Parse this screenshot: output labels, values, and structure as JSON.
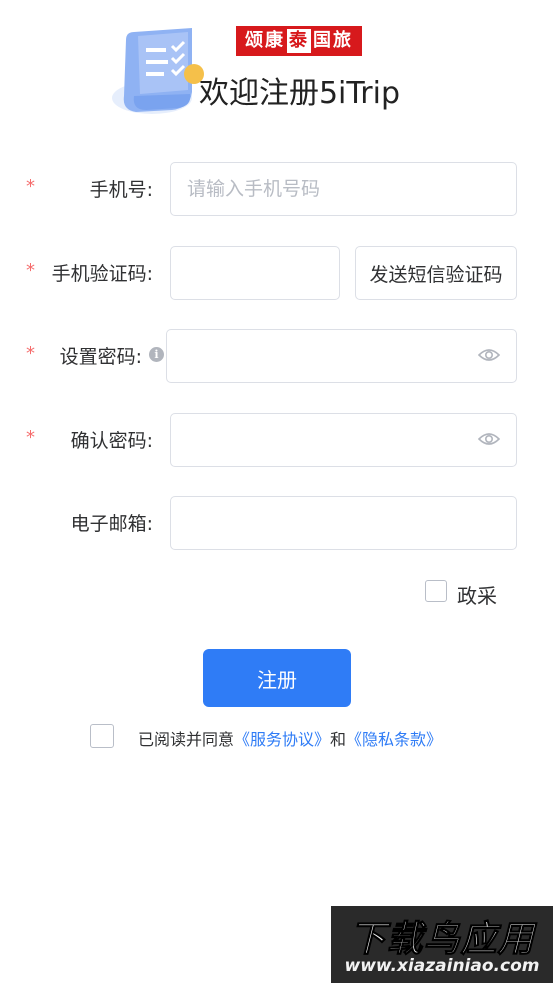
{
  "header": {
    "brand_text_left": "颂康",
    "brand_text_mid": "泰",
    "brand_text_right": "国旅",
    "title": "欢迎注册5iTrip"
  },
  "form": {
    "phone": {
      "required_mark": "*",
      "label": "手机号:",
      "placeholder": "请输入手机号码",
      "value": ""
    },
    "sms_code": {
      "required_mark": "*",
      "label": "手机验证码:",
      "value": "",
      "button_label": "发送短信验证码"
    },
    "password": {
      "required_mark": "*",
      "label": "设置密码:",
      "info_icon": "i",
      "value": ""
    },
    "confirm_password": {
      "required_mark": "*",
      "label": "确认密码:",
      "value": ""
    },
    "email": {
      "label": "电子邮箱:",
      "value": ""
    },
    "policy_checkbox_label": "政采",
    "submit_label": "注册",
    "agreement": {
      "prefix": "已阅读并同意",
      "service_link": "《服务协议》",
      "conjunction": "和",
      "privacy_link": "《隐私条款》"
    }
  },
  "watermark": {
    "main": "下载鸟应用",
    "url": "www.xiazainiao.com"
  },
  "colors": {
    "primary": "#2f7cf6",
    "required": "#f56c6c",
    "border": "#dcdfe6",
    "brand_red": "#d7191c"
  },
  "icons": {
    "password_visibility": "eye-icon",
    "confirm_visibility": "eye-icon",
    "info": "info-icon"
  }
}
